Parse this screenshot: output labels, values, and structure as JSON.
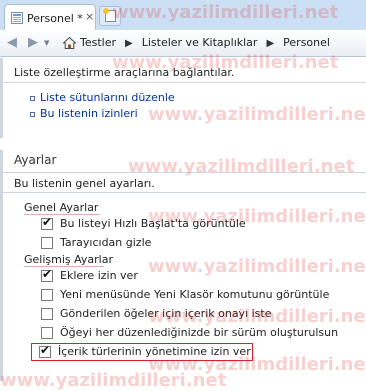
{
  "browser": {
    "tab_title": "Personel *",
    "close_glyph": "×",
    "breadcrumb": [
      "Testler",
      "Listeler ve Kitaplıklar",
      "Personel"
    ],
    "breadcrumb_separator": "▶"
  },
  "top_panel": {
    "description": "Liste özelleştirme araçlarına bağlantılar.",
    "links": [
      "Liste sütunlarını düzenle",
      "Bu listenin izinleri"
    ]
  },
  "settings": {
    "title": "Ayarlar",
    "subtitle": "Bu listenin genel ayarları.",
    "general": {
      "heading": "Genel Ayarlar",
      "options": [
        {
          "label": "Bu listeyi Hızlı Başlat'ta görüntüle",
          "checked": true
        },
        {
          "label": "Tarayıcıdan gizle",
          "checked": false
        }
      ]
    },
    "advanced": {
      "heading": "Gelişmiş Ayarlar",
      "options": [
        {
          "label": "Eklere izin ver",
          "checked": true
        },
        {
          "label": "Yeni menüsünde Yeni Klasör komutunu görüntüle",
          "checked": false
        },
        {
          "label": "Gönderilen öğeler için içerik onayı iste",
          "checked": false
        },
        {
          "label": "Öğeyi her düzenlediğinizde bir sürüm oluşturulsun",
          "checked": false
        },
        {
          "label": "İçerik türlerinin yönetimine izin ver",
          "checked": true
        }
      ]
    }
  },
  "watermark": "www.yazilimdilleri.net",
  "colors": {
    "link": "#003399",
    "highlight_border": "#d9202a",
    "watermark": "#e12828"
  }
}
